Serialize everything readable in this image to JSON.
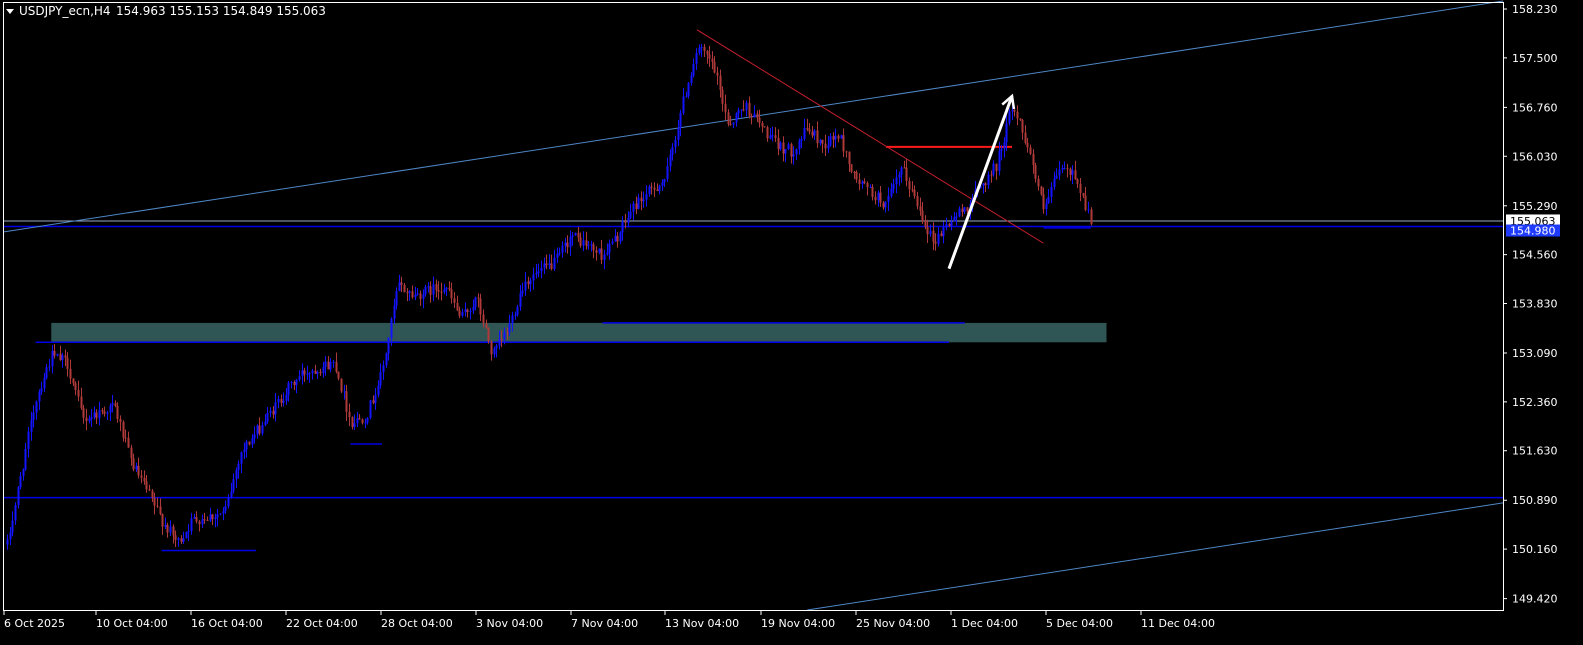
{
  "header": {
    "symbol": "USDJPY_ecn,H4",
    "ohlc": "154.963 155.153 154.849 155.063"
  },
  "colors": {
    "background": "#000000",
    "frame": "#ffffff",
    "axis_text": "#ffffff",
    "bull_candle": "#1414ff",
    "bear_candle": "#b03a3a",
    "level_line": "#0000e6",
    "channel_line": "#4f86c6",
    "trend_line": "#c8202e",
    "red_level": "#ff1a1a",
    "arrow": "#ffffff",
    "zone_fill": "#2f5554",
    "bid_line": "#9aa8c4",
    "ask_label_bg": "#1f3bff"
  },
  "chart_data": {
    "type": "candlestick",
    "symbol": "USDJPY_ecn",
    "timeframe": "H4",
    "price_axis": {
      "ticks": [
        "158.230",
        "157.500",
        "156.760",
        "156.030",
        "155.290",
        "154.560",
        "153.830",
        "153.090",
        "152.360",
        "151.630",
        "150.890",
        "150.160",
        "149.420"
      ],
      "range": [
        149.25,
        158.32
      ]
    },
    "time_axis": {
      "ticks": [
        "6 Oct 2025",
        "10 Oct 04:00",
        "16 Oct 04:00",
        "22 Oct 04:00",
        "28 Oct 04:00",
        "3 Nov 04:00",
        "7 Nov 04:00",
        "13 Nov 04:00",
        "19 Nov 04:00",
        "25 Nov 04:00",
        "1 Dec 04:00",
        "5 Dec 04:00",
        "11 Dec 04:00"
      ]
    },
    "current_price_labels": {
      "bid": "155.063",
      "ask": "154.980"
    },
    "price_path": [
      {
        "date": "6 Oct 2025",
        "price": 150.0
      },
      {
        "date": "8 Oct",
        "price": 152.4
      },
      {
        "date": "9 Oct",
        "price": 153.05
      },
      {
        "date": "10 Oct",
        "price": 152.95
      },
      {
        "date": "11 Oct",
        "price": 152.1
      },
      {
        "date": "13 Oct",
        "price": 152.3
      },
      {
        "date": "14 Oct",
        "price": 151.5
      },
      {
        "date": "16 Oct",
        "price": 150.6
      },
      {
        "date": "17 Oct",
        "price": 150.25
      },
      {
        "date": "18 Oct",
        "price": 150.6
      },
      {
        "date": "20 Oct",
        "price": 150.7
      },
      {
        "date": "21 Oct",
        "price": 151.6
      },
      {
        "date": "22 Oct",
        "price": 151.9
      },
      {
        "date": "24 Oct",
        "price": 152.55
      },
      {
        "date": "25 Oct",
        "price": 152.8
      },
      {
        "date": "27 Oct",
        "price": 152.95
      },
      {
        "date": "28 Oct",
        "price": 152.05
      },
      {
        "date": "29 Oct",
        "price": 152.15
      },
      {
        "date": "30 Oct",
        "price": 152.8
      },
      {
        "date": "31 Oct",
        "price": 154.1
      },
      {
        "date": "1 Nov",
        "price": 153.95
      },
      {
        "date": "3 Nov",
        "price": 154.1
      },
      {
        "date": "4 Nov",
        "price": 153.6
      },
      {
        "date": "5 Nov",
        "price": 153.9
      },
      {
        "date": "6 Nov",
        "price": 153.05
      },
      {
        "date": "7 Nov",
        "price": 153.45
      },
      {
        "date": "8 Nov",
        "price": 154.15
      },
      {
        "date": "10 Nov",
        "price": 154.45
      },
      {
        "date": "11 Nov",
        "price": 154.85
      },
      {
        "date": "12 Nov",
        "price": 154.7
      },
      {
        "date": "13 Nov",
        "price": 154.55
      },
      {
        "date": "14 Nov",
        "price": 154.85
      },
      {
        "date": "15 Nov",
        "price": 155.3
      },
      {
        "date": "17 Nov",
        "price": 155.7
      },
      {
        "date": "18 Nov",
        "price": 156.75
      },
      {
        "date": "19 Nov",
        "price": 157.65
      },
      {
        "date": "20 Nov",
        "price": 157.4
      },
      {
        "date": "21 Nov",
        "price": 156.5
      },
      {
        "date": "22 Nov",
        "price": 156.8
      },
      {
        "date": "24 Nov",
        "price": 156.2
      },
      {
        "date": "25 Nov",
        "price": 156.1
      },
      {
        "date": "26 Nov",
        "price": 156.45
      },
      {
        "date": "27 Nov",
        "price": 156.2
      },
      {
        "date": "28 Nov",
        "price": 156.35
      },
      {
        "date": "29 Nov",
        "price": 155.7
      },
      {
        "date": "1 Dec",
        "price": 155.3
      },
      {
        "date": "2 Dec",
        "price": 155.85
      },
      {
        "date": "3 Dec",
        "price": 155.3
      },
      {
        "date": "4 Dec",
        "price": 154.75
      },
      {
        "date": "5 Dec",
        "price": 155.05
      },
      {
        "date": "6 Dec",
        "price": 155.25
      },
      {
        "date": "8 Dec",
        "price": 155.9
      },
      {
        "date": "9 Dec",
        "price": 156.8
      },
      {
        "date": "10 Dec",
        "price": 156.2
      },
      {
        "date": "11 Dec",
        "price": 155.2
      },
      {
        "date": "12 Dec",
        "price": 155.85
      },
      {
        "date": "13 Dec",
        "price": 155.75
      },
      {
        "date": "14 Dec",
        "price": 155.06
      }
    ],
    "horizontal_levels": [
      {
        "kind": "level",
        "price": 154.98,
        "from": "6 Oct 2025",
        "to": "edge"
      },
      {
        "kind": "level",
        "price": 150.93,
        "from": "6 Oct 2025",
        "to": "edge"
      },
      {
        "kind": "level",
        "price": 153.25,
        "from": "8 Oct",
        "to": "5 Dec"
      },
      {
        "kind": "level",
        "price": 153.54,
        "from": "13 Nov",
        "to": "6 Dec"
      },
      {
        "kind": "level",
        "price": 151.73,
        "from": "28 Oct",
        "to": "30 Oct"
      },
      {
        "kind": "level",
        "price": 150.14,
        "from": "16 Oct",
        "to": "22 Oct"
      },
      {
        "kind": "level",
        "price": 154.96,
        "from": "11 Dec",
        "to": "14 Dec"
      },
      {
        "kind": "resistance",
        "price": 156.17,
        "from": "1 Dec",
        "to": "9 Dec"
      }
    ],
    "zones": [
      {
        "kind": "supply_demand_zone",
        "from": "9 Oct",
        "to": "15 Dec",
        "price_low": 153.25,
        "price_high": 153.54
      }
    ],
    "trend_lines": [
      {
        "kind": "channel_upper",
        "from": {
          "date": "6 Oct 2025",
          "price": 154.9
        },
        "to": {
          "date": "edge",
          "price": 158.35
        }
      },
      {
        "kind": "channel_lower",
        "from": {
          "date": "26 Nov",
          "price": 149.25
        },
        "to": {
          "date": "edge",
          "price": 150.85
        }
      },
      {
        "kind": "downtrend",
        "from": {
          "date": "19 Nov",
          "price": 157.92
        },
        "to": {
          "date": "11 Dec",
          "price": 154.73
        }
      }
    ],
    "arrows": [
      {
        "from": {
          "date": "5 Dec",
          "price": 154.35
        },
        "to": {
          "date": "9 Dec",
          "price": 156.93
        }
      }
    ],
    "grid": false,
    "legend": "none"
  }
}
